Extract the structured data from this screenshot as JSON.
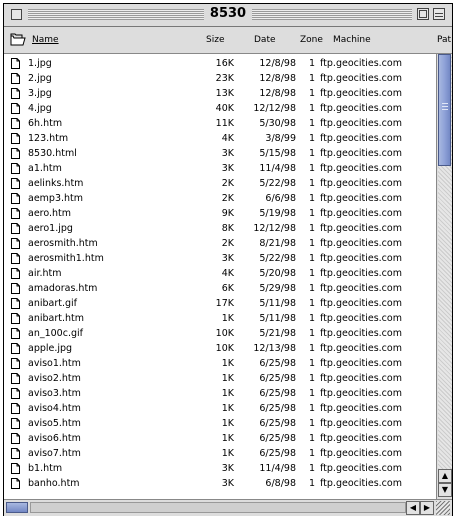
{
  "window": {
    "title": "8530"
  },
  "columns": {
    "name": "Name",
    "size": "Size",
    "date": "Date",
    "zone": "Zone",
    "machine": "Machine",
    "path": "Pat"
  },
  "files": [
    {
      "name": "1.jpg",
      "size": "16K",
      "date": "12/8/98",
      "zone": "1",
      "machine": "ftp.geocities.com"
    },
    {
      "name": "2.jpg",
      "size": "23K",
      "date": "12/8/98",
      "zone": "1",
      "machine": "ftp.geocities.com"
    },
    {
      "name": "3.jpg",
      "size": "13K",
      "date": "12/8/98",
      "zone": "1",
      "machine": "ftp.geocities.com"
    },
    {
      "name": "4.jpg",
      "size": "40K",
      "date": "12/12/98",
      "zone": "1",
      "machine": "ftp.geocities.com"
    },
    {
      "name": "6h.htm",
      "size": "11K",
      "date": "5/30/98",
      "zone": "1",
      "machine": "ftp.geocities.com"
    },
    {
      "name": "123.htm",
      "size": "4K",
      "date": "3/8/99",
      "zone": "1",
      "machine": "ftp.geocities.com"
    },
    {
      "name": "8530.html",
      "size": "3K",
      "date": "5/15/98",
      "zone": "1",
      "machine": "ftp.geocities.com"
    },
    {
      "name": "a1.htm",
      "size": "3K",
      "date": "11/4/98",
      "zone": "1",
      "machine": "ftp.geocities.com"
    },
    {
      "name": "aelinks.htm",
      "size": "2K",
      "date": "5/22/98",
      "zone": "1",
      "machine": "ftp.geocities.com"
    },
    {
      "name": "aemp3.htm",
      "size": "2K",
      "date": "6/6/98",
      "zone": "1",
      "machine": "ftp.geocities.com"
    },
    {
      "name": "aero.htm",
      "size": "9K",
      "date": "5/19/98",
      "zone": "1",
      "machine": "ftp.geocities.com"
    },
    {
      "name": "aero1.jpg",
      "size": "8K",
      "date": "12/12/98",
      "zone": "1",
      "machine": "ftp.geocities.com"
    },
    {
      "name": "aerosmith.htm",
      "size": "2K",
      "date": "8/21/98",
      "zone": "1",
      "machine": "ftp.geocities.com"
    },
    {
      "name": "aerosmith1.htm",
      "size": "3K",
      "date": "5/22/98",
      "zone": "1",
      "machine": "ftp.geocities.com"
    },
    {
      "name": "air.htm",
      "size": "4K",
      "date": "5/20/98",
      "zone": "1",
      "machine": "ftp.geocities.com"
    },
    {
      "name": "amadoras.htm",
      "size": "6K",
      "date": "5/29/98",
      "zone": "1",
      "machine": "ftp.geocities.com"
    },
    {
      "name": "anibart.gif",
      "size": "17K",
      "date": "5/11/98",
      "zone": "1",
      "machine": "ftp.geocities.com"
    },
    {
      "name": "anibart.htm",
      "size": "1K",
      "date": "5/11/98",
      "zone": "1",
      "machine": "ftp.geocities.com"
    },
    {
      "name": "an_100c.gif",
      "size": "10K",
      "date": "5/21/98",
      "zone": "1",
      "machine": "ftp.geocities.com"
    },
    {
      "name": "apple.jpg",
      "size": "10K",
      "date": "12/13/98",
      "zone": "1",
      "machine": "ftp.geocities.com"
    },
    {
      "name": "aviso1.htm",
      "size": "1K",
      "date": "6/25/98",
      "zone": "1",
      "machine": "ftp.geocities.com"
    },
    {
      "name": "aviso2.htm",
      "size": "1K",
      "date": "6/25/98",
      "zone": "1",
      "machine": "ftp.geocities.com"
    },
    {
      "name": "aviso3.htm",
      "size": "1K",
      "date": "6/25/98",
      "zone": "1",
      "machine": "ftp.geocities.com"
    },
    {
      "name": "aviso4.htm",
      "size": "1K",
      "date": "6/25/98",
      "zone": "1",
      "machine": "ftp.geocities.com"
    },
    {
      "name": "aviso5.htm",
      "size": "1K",
      "date": "6/25/98",
      "zone": "1",
      "machine": "ftp.geocities.com"
    },
    {
      "name": "aviso6.htm",
      "size": "1K",
      "date": "6/25/98",
      "zone": "1",
      "machine": "ftp.geocities.com"
    },
    {
      "name": "aviso7.htm",
      "size": "1K",
      "date": "6/25/98",
      "zone": "1",
      "machine": "ftp.geocities.com"
    },
    {
      "name": "b1.htm",
      "size": "3K",
      "date": "11/4/98",
      "zone": "1",
      "machine": "ftp.geocities.com"
    },
    {
      "name": "banho.htm",
      "size": "3K",
      "date": "6/8/98",
      "zone": "1",
      "machine": "ftp.geocities.com"
    }
  ],
  "icons": {
    "close": "close-box-icon",
    "zoom": "zoom-box-icon",
    "collapse": "collapse-box-icon",
    "folder": "folder-icon",
    "file": "document-icon",
    "scroll_up": "up-arrow-icon",
    "scroll_down": "down-arrow-icon",
    "scroll_left": "left-arrow-icon",
    "scroll_right": "right-arrow-icon",
    "grow": "grow-box-icon"
  },
  "colors": {
    "window_bg": "#dddddd",
    "list_bg": "#ffffff",
    "thumb": "#8fa2d8"
  }
}
